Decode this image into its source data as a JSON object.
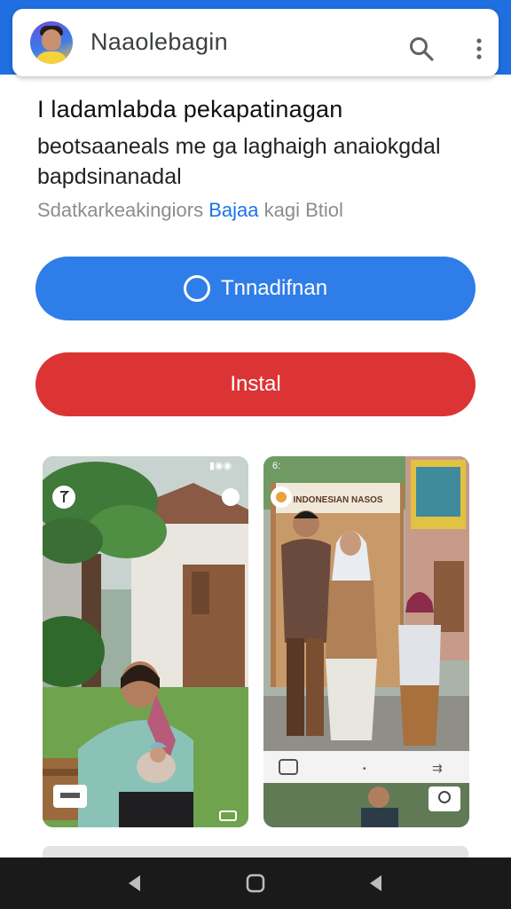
{
  "header": {
    "app_title": "Naaolebagin",
    "icons": [
      "avatar",
      "search-icon",
      "more-vert-icon"
    ]
  },
  "listing": {
    "headline": "I ladamlabda pekapatinagan",
    "description": "beotsaaneals me ga laghaigh anaiokgdal bapdsinanadal",
    "meta_prefix": "Sdatkarkeakingiors",
    "meta_link": "Bajaa",
    "meta_suffix": "kagi Btiol"
  },
  "actions": {
    "primary_label": "Tnnadifnan",
    "install_label": "Instal"
  },
  "screenshots": {
    "right_sign": "INDONESIAN NASOS"
  },
  "colors": {
    "brand_blue": "#2f7de9",
    "install_red": "#dc3434",
    "link_blue": "#1a73e8"
  }
}
